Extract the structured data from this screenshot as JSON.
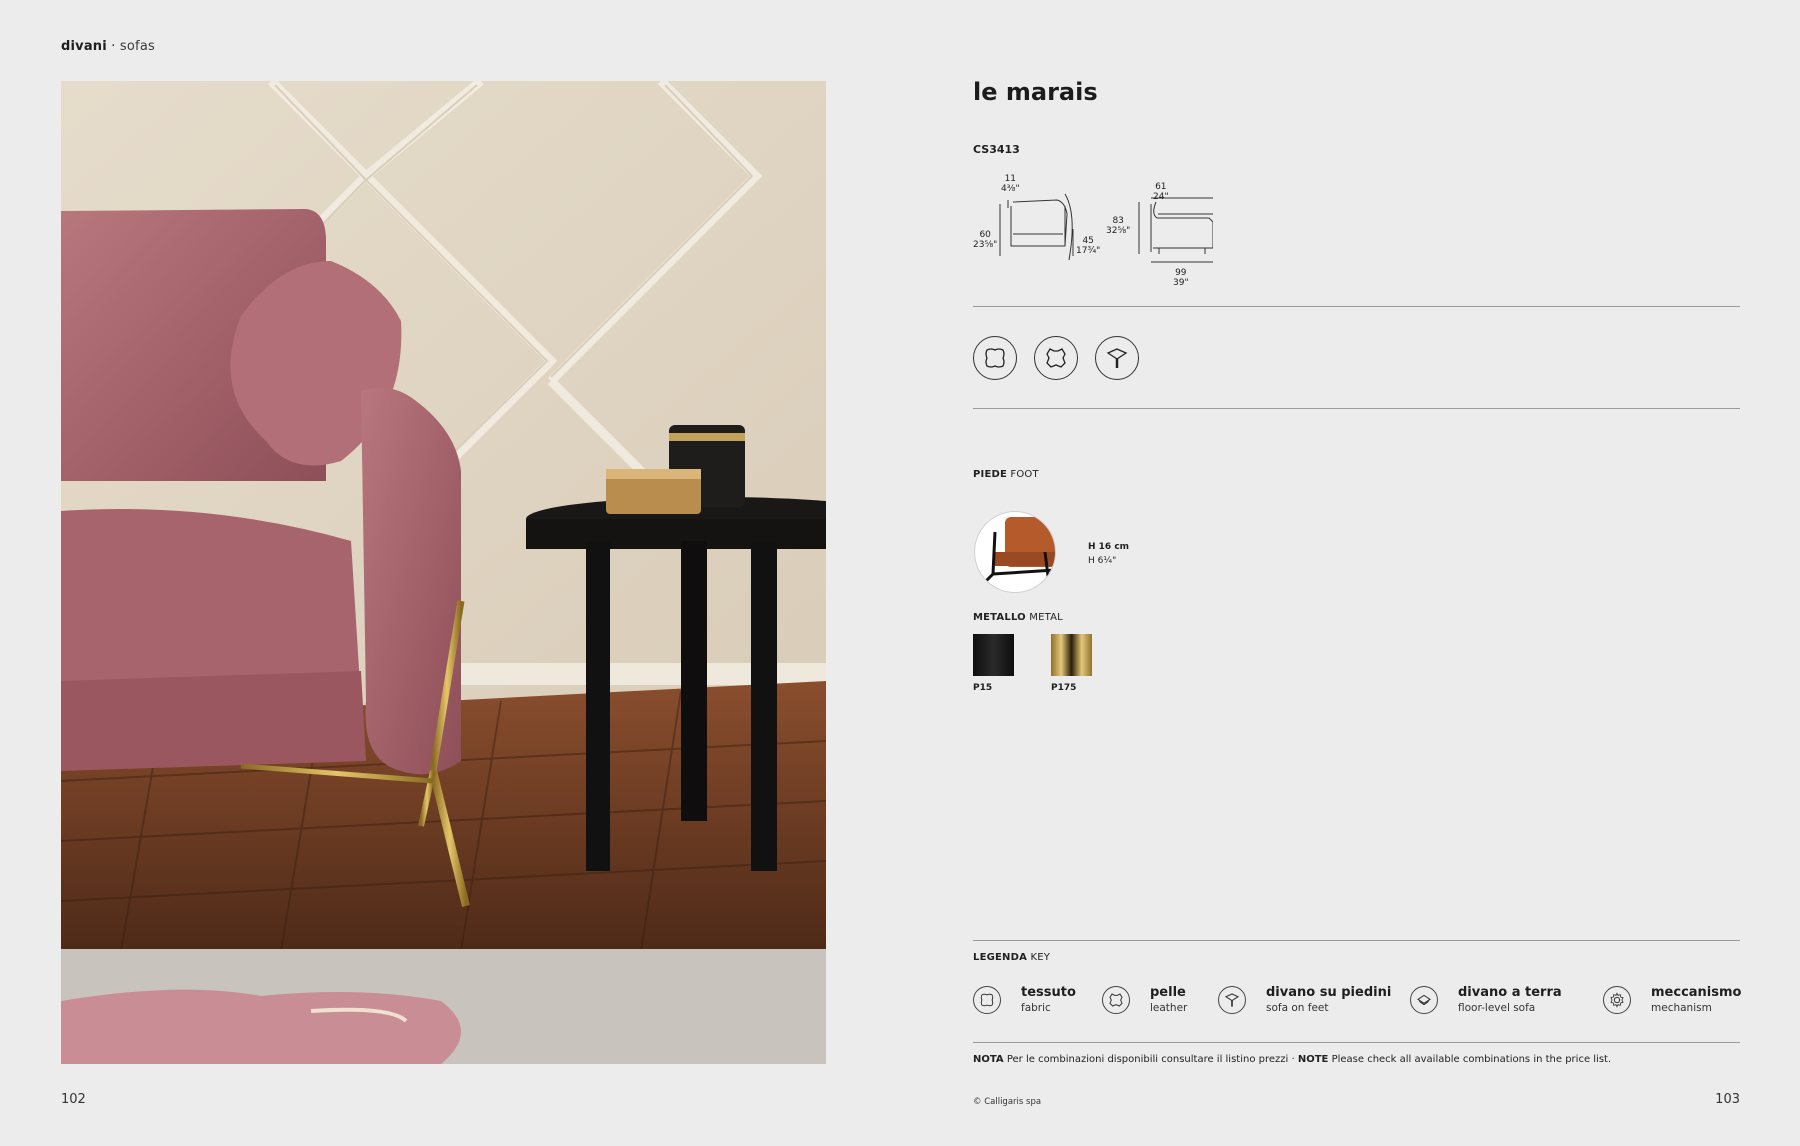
{
  "header": {
    "section_bold": "divani",
    "section_sep": " · ",
    "section_light": "sofas"
  },
  "pages": {
    "left": "102",
    "right": "103"
  },
  "product": {
    "name": "le marais",
    "code": "CS3413"
  },
  "dimensions": {
    "front": {
      "top_cm": "11",
      "top_in": "4⅜\"",
      "height_cm": "60",
      "height_in": "23⅝\"",
      "seat_cm": "45",
      "seat_in": "17¾\""
    },
    "side": {
      "depth_top_cm": "61",
      "depth_top_in": "24\"",
      "height_cm": "83",
      "height_in": "32⅝\"",
      "width_cm": "99",
      "width_in": "39\""
    }
  },
  "feature_icons": [
    "fabric-icon",
    "leather-icon",
    "feet-icon"
  ],
  "foot": {
    "label_it": "PIEDE",
    "label_en": "FOOT",
    "height_cm": "H 16 cm",
    "height_in": "H 6¼\""
  },
  "metal": {
    "label_it": "METALLO",
    "label_en": "METAL",
    "swatches": [
      {
        "code": "P15",
        "color": "#141414"
      },
      {
        "code": "P175",
        "color": "#b8953f"
      }
    ]
  },
  "legend": {
    "label_it": "LEGENDA",
    "label_en": "KEY",
    "items": [
      {
        "title": "tessuto",
        "sub": "fabric",
        "icon": "fabric-icon"
      },
      {
        "title": "pelle",
        "sub": "leather",
        "icon": "leather-icon"
      },
      {
        "title": "divano su piedini",
        "sub": "sofa on feet",
        "icon": "feet-icon"
      },
      {
        "title": "divano a terra",
        "sub": "floor-level sofa",
        "icon": "floor-icon"
      },
      {
        "title": "meccanismo",
        "sub": "mechanism",
        "icon": "gear-icon"
      }
    ]
  },
  "note": {
    "label_it": "NOTA",
    "text_it": "Per le combinazioni disponibili consultare il listino prezzi · ",
    "label_en": "NOTE",
    "text_en": "Please check all available combinations in the price list."
  },
  "copyright": "© Calligaris spa"
}
